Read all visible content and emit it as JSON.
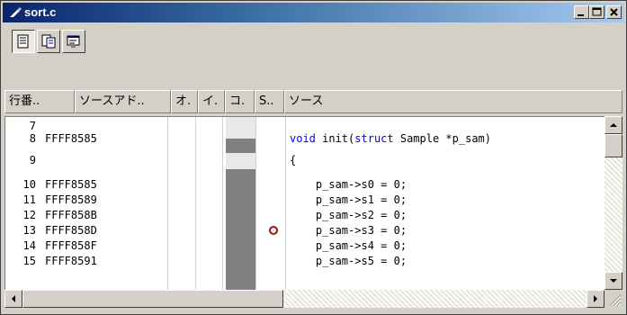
{
  "window": {
    "title": "sort.c"
  },
  "title_buttons": {
    "minimize": "minimize-icon",
    "maximize": "maximize-icon",
    "close": "close-icon"
  },
  "toolbar": {
    "buttons": [
      {
        "icon": "source-view-icon",
        "pressed": true
      },
      {
        "icon": "mixed-view-icon",
        "pressed": false
      },
      {
        "icon": "disassembly-view-icon",
        "pressed": false
      }
    ]
  },
  "columns": [
    "行番..",
    "ソースアド..",
    "オ.",
    "イ.",
    "コ.",
    "S..",
    "ソース"
  ],
  "rows": [
    {
      "line": "7",
      "addr": "",
      "src": ""
    },
    {
      "line": "8",
      "addr": "FFFF8585",
      "src_kw": "void",
      "src_mid": " init(",
      "src_kw2": "struct",
      "src_tail": " Sample *p_sam)"
    },
    {
      "line": "9",
      "addr": "",
      "src": "{"
    },
    {
      "line": "10",
      "addr": "FFFF8585",
      "src": "    p_sam->s0 = 0;"
    },
    {
      "line": "11",
      "addr": "FFFF8589",
      "src": "    p_sam->s1 = 0;"
    },
    {
      "line": "12",
      "addr": "FFFF858B",
      "src": "    p_sam->s2 = 0;"
    },
    {
      "line": "13",
      "addr": "FFFF858D",
      "src": "    p_sam->s3 = 0;"
    },
    {
      "line": "14",
      "addr": "FFFF858F",
      "src": "    p_sam->s4 = 0;"
    },
    {
      "line": "15",
      "addr": "FFFF8591",
      "src": "    p_sam->s5 = 0;"
    }
  ],
  "breakpoint_line": "13",
  "colors": {
    "keyword": "#0000ff",
    "coverage": "#808080",
    "breakpoint": "#a01010"
  }
}
